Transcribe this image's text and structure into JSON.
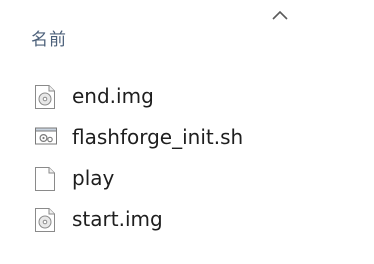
{
  "header": {
    "column_label": "名前",
    "sort_direction": "ascending",
    "sort_icon": "chevron-up-icon"
  },
  "files": [
    {
      "name": "end.img",
      "icon": "disc-image-file-icon"
    },
    {
      "name": "flashforge_init.sh",
      "icon": "script-file-icon"
    },
    {
      "name": "play",
      "icon": "blank-file-icon"
    },
    {
      "name": "start.img",
      "icon": "disc-image-file-icon"
    }
  ]
}
